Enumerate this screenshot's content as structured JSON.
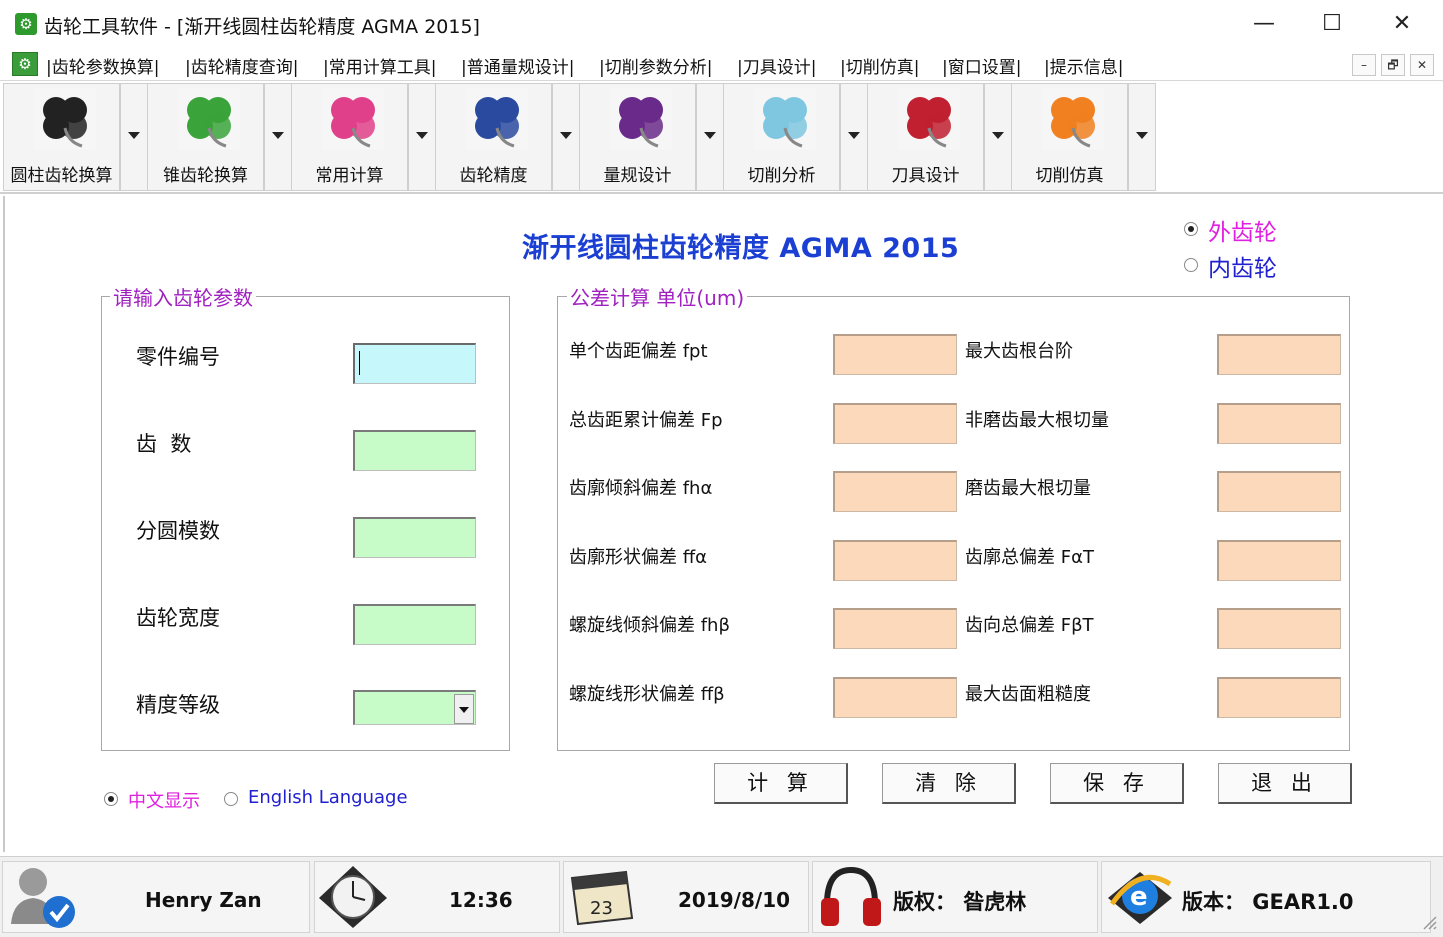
{
  "window": {
    "title": "齿轮工具软件 - [渐开线圆柱齿轮精度 AGMA 2015]",
    "minimize": "—",
    "maximize": "☐",
    "close": "✕"
  },
  "menu": [
    "|齿轮参数换算|",
    "|齿轮精度查询|",
    "|常用计算工具|",
    "|普通量规设计|",
    "|切削参数分析|",
    "|刀具设计|",
    "|切削仿真|",
    "|窗口设置|",
    "|提示信息|"
  ],
  "mdi_controls": [
    "–",
    "🗗",
    "✕"
  ],
  "toolbar": [
    {
      "label": "圆柱齿轮换算",
      "icon": "clover-black-icon",
      "color": "#222222"
    },
    {
      "label": "锥齿轮换算",
      "icon": "clover-green-icon",
      "color": "#3aa33a"
    },
    {
      "label": "常用计算",
      "icon": "clover-multicolor-icon",
      "color": "#e0408a"
    },
    {
      "label": "齿轮精度",
      "icon": "clover-blue-icon",
      "color": "#2a4aa0"
    },
    {
      "label": "量规设计",
      "icon": "clover-purple-icon",
      "color": "#6a2a8a"
    },
    {
      "label": "切削分析",
      "icon": "clover-lightblue-icon",
      "color": "#7fc7e0"
    },
    {
      "label": "刀具设计",
      "icon": "clover-red-icon",
      "color": "#c02030"
    },
    {
      "label": "切削仿真",
      "icon": "clover-orange-icon",
      "color": "#f08020"
    }
  ],
  "page": {
    "title": "渐开线圆柱齿轮精度 AGMA 2015",
    "gear_type": {
      "options": [
        "外齿轮",
        "内齿轮"
      ],
      "selected": "外齿轮",
      "colors": [
        "#e020e0",
        "#2020d0"
      ]
    },
    "input_group": {
      "label": "请输入齿轮参数",
      "fields": [
        {
          "label": "零件编号",
          "value": ""
        },
        {
          "label": "齿  数",
          "value": ""
        },
        {
          "label": "分圆模数",
          "value": ""
        },
        {
          "label": "齿轮宽度",
          "value": ""
        },
        {
          "label": "精度等级",
          "value": ""
        }
      ]
    },
    "output_group": {
      "label": "公差计算 单位(um)",
      "left": [
        "单个齿距偏差 fpt",
        "总齿距累计偏差 Fp",
        "齿廓倾斜偏差 fhα",
        "齿廓形状偏差 ffα",
        "螺旋线倾斜偏差 fhβ",
        "螺旋线形状偏差 ffβ"
      ],
      "right": [
        "最大齿根台阶",
        "非磨齿最大根切量",
        "磨齿最大根切量",
        "齿廓总偏差 FαT",
        "齿向总偏差 FβT",
        "最大齿面粗糙度"
      ]
    },
    "language": {
      "options": [
        "中文显示",
        "English Language"
      ],
      "selected": "中文显示"
    },
    "buttons": [
      "计 算",
      "清 除",
      "保 存",
      "退 出"
    ]
  },
  "status": {
    "user": "Henry Zan",
    "time": "12:36",
    "calendar_day": "23",
    "date": "2019/8/10",
    "copyright": "版权： 昝虎林",
    "version": "版本： GEAR1.0"
  }
}
